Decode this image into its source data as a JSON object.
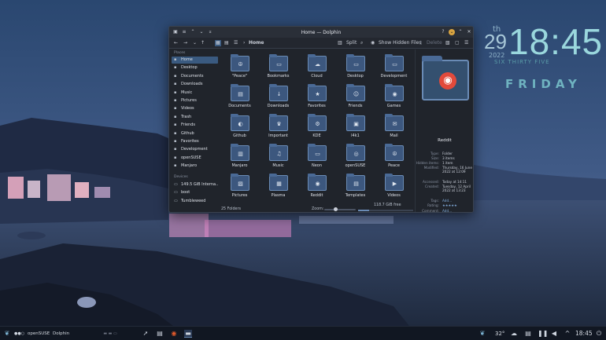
{
  "window": {
    "title": "Home — Dolphin",
    "toolbar": {
      "back_glyph": "←",
      "forward_glyph": "→",
      "up_glyph": "↑",
      "breadcrumb": "Home",
      "split_label": "Split",
      "hidden_label": "Show Hidden Files",
      "delete_label": "Delete"
    }
  },
  "sidebar": {
    "places_heading": "Places",
    "devices_heading": "Devices",
    "places": [
      {
        "label": "Home",
        "icon": "home-icon",
        "active": true
      },
      {
        "label": "Desktop",
        "icon": "desktop-icon"
      },
      {
        "label": "Documents",
        "icon": "documents-icon"
      },
      {
        "label": "Downloads",
        "icon": "downloads-icon"
      },
      {
        "label": "Music",
        "icon": "music-icon"
      },
      {
        "label": "Pictures",
        "icon": "pictures-icon"
      },
      {
        "label": "Videos",
        "icon": "videos-icon"
      },
      {
        "label": "Trash",
        "icon": "trash-icon"
      },
      {
        "label": "Friends",
        "icon": "friends-icon"
      },
      {
        "label": "Github",
        "icon": "github-icon"
      },
      {
        "label": "Favorites",
        "icon": "star-icon"
      },
      {
        "label": "Development",
        "icon": "development-icon"
      },
      {
        "label": "openSUSE",
        "icon": "opensuse-icon"
      },
      {
        "label": "Manjaro",
        "icon": "manjaro-icon"
      }
    ],
    "devices": [
      {
        "label": "149.5 GiB Interna...",
        "icon": "drive-icon"
      },
      {
        "label": "boot",
        "icon": "drive-icon"
      },
      {
        "label": "Tumbleweed",
        "icon": "drive-icon"
      }
    ]
  },
  "files": [
    {
      "label": "\"Peace\"",
      "emblem": "☮"
    },
    {
      "label": "Bookmarks",
      "emblem": "▭"
    },
    {
      "label": "Cloud",
      "emblem": "☁"
    },
    {
      "label": "Desktop",
      "emblem": "▭"
    },
    {
      "label": "Development",
      "emblem": "▭"
    },
    {
      "label": "Documents",
      "emblem": "▤"
    },
    {
      "label": "Downloads",
      "emblem": "↓"
    },
    {
      "label": "Favorites",
      "emblem": "★"
    },
    {
      "label": "Friends",
      "emblem": "☺"
    },
    {
      "label": "Games",
      "emblem": "◉"
    },
    {
      "label": "Github",
      "emblem": "◐"
    },
    {
      "label": "Important",
      "emblem": "♛"
    },
    {
      "label": "KDE",
      "emblem": "⚙"
    },
    {
      "label": "l4k1",
      "emblem": "▣"
    },
    {
      "label": "Mail",
      "emblem": "✉"
    },
    {
      "label": "Manjaro",
      "emblem": "▥"
    },
    {
      "label": "Music",
      "emblem": "♫"
    },
    {
      "label": "Neon",
      "emblem": "▭"
    },
    {
      "label": "openSUSE",
      "emblem": "◎"
    },
    {
      "label": "Peace",
      "emblem": "☮"
    },
    {
      "label": "Pictures",
      "emblem": "▨"
    },
    {
      "label": "Plasma",
      "emblem": "▦"
    },
    {
      "label": "Reddit",
      "emblem": "◉"
    },
    {
      "label": "Templates",
      "emblem": "▤"
    },
    {
      "label": "Videos",
      "emblem": "▶"
    }
  ],
  "status": {
    "count": "25 Folders",
    "zoom_label": "Zoom:",
    "free": "118.7 GiB free",
    "free_fraction": 0.2
  },
  "info": {
    "name": "Reddit",
    "rows": [
      {
        "k": "Type:",
        "v": "Folder"
      },
      {
        "k": "Size:",
        "v": "3 items"
      },
      {
        "k": "Hidden items:",
        "v": "1 item"
      },
      {
        "k": "Modified:",
        "v": "Thursday, 16 June 2022 at 12:09"
      },
      {
        "k": "Accessed:",
        "v": "Today at 14:11"
      },
      {
        "k": "Created:",
        "v": "Tuesday, 12 April 2022 at 13:23"
      },
      {
        "k": "Tags:",
        "v": "Add..."
      },
      {
        "k": "Rating:",
        "v": "★★★★★"
      },
      {
        "k": "Comment:",
        "v": "Add..."
      }
    ]
  },
  "clock": {
    "day_of_week_short": "th",
    "date": "29",
    "year": "2022",
    "time": "18:45",
    "spoken": "SIX THIRTY FIVE",
    "weekday": "FRIDAY"
  },
  "panel": {
    "desktop_name": "openSUSE",
    "task": "Dolphin",
    "temp": "32°",
    "time": "18:45"
  },
  "colors": {
    "accent": "#3a5a80",
    "folder": "#3c577e",
    "panel": "#111722"
  }
}
